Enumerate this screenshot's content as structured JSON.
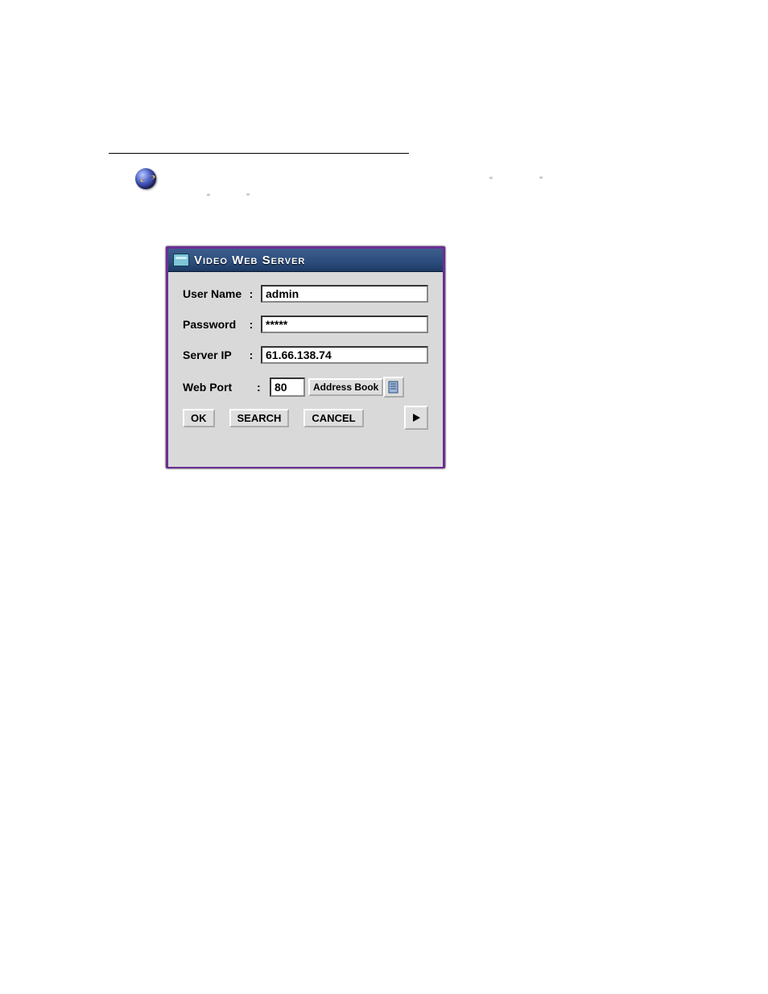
{
  "dialog": {
    "title": "Video Web Server",
    "fields": {
      "username": {
        "label": "User Name",
        "value": "admin"
      },
      "password": {
        "label": "Password",
        "value": "*****"
      },
      "server_ip": {
        "label": "Server IP",
        "value": "61.66.138.74"
      },
      "web_port": {
        "label": "Web Port",
        "value": "80"
      }
    },
    "buttons": {
      "address_book": "Address Book",
      "ok": "OK",
      "search": "SEARCH",
      "cancel": "CANCEL"
    }
  },
  "artifacts": {
    "q1": "“",
    "q2": "”",
    "q3": "“",
    "q4": "”"
  }
}
